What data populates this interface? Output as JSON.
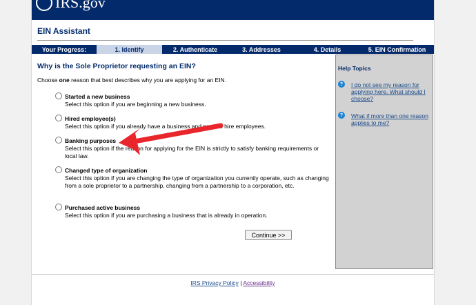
{
  "header": {
    "logo_text": "IRS.gov"
  },
  "page": {
    "title": "EIN Assistant"
  },
  "progress": {
    "label": "Your Progress:",
    "steps": [
      {
        "label": "1. Identify",
        "active": true
      },
      {
        "label": "2. Authenticate",
        "active": false
      },
      {
        "label": "3. Addresses",
        "active": false
      },
      {
        "label": "4. Details",
        "active": false
      },
      {
        "label": "5. EIN Confirmation",
        "active": false
      }
    ]
  },
  "main": {
    "question": "Why is the Sole Proprietor requesting an EIN?",
    "instruction_pre": "Choose ",
    "instruction_bold": "one",
    "instruction_post": " reason that best describes why you are applying for an EIN.",
    "options": [
      {
        "title": "Started a new business",
        "description": "Select this option if you are beginning a new business."
      },
      {
        "title": "Hired employee(s)",
        "description": "Select this option if you already have a business and need to hire employees."
      },
      {
        "title": "Banking purposes",
        "description": "Select this option if the reason for applying for the EIN is strictly to satisfy banking requirements or local law."
      },
      {
        "title": "Changed type of organization",
        "description": "Select this option if you are changing the type of organization you currently operate, such as changing from a sole proprietor to a partnership, changing from a partnership to a corporation, etc."
      },
      {
        "title": "Purchased active business",
        "description": "Select this option if you are purchasing a business that is already in operation."
      }
    ],
    "continue_label": "Continue >>"
  },
  "help": {
    "title": "Help Topics",
    "icon_glyph": "?",
    "items": [
      {
        "label": "I do not see my reason for applying here. What should I choose?"
      },
      {
        "label": "What if more than one reason applies to me?"
      }
    ]
  },
  "footer": {
    "privacy": "IRS Privacy Policy",
    "separator": "|",
    "accessibility": "Accessibility"
  },
  "colors": {
    "navy": "#032a6b",
    "annotation_arrow": "#e8262c",
    "help_icon": "#1a83d6"
  }
}
